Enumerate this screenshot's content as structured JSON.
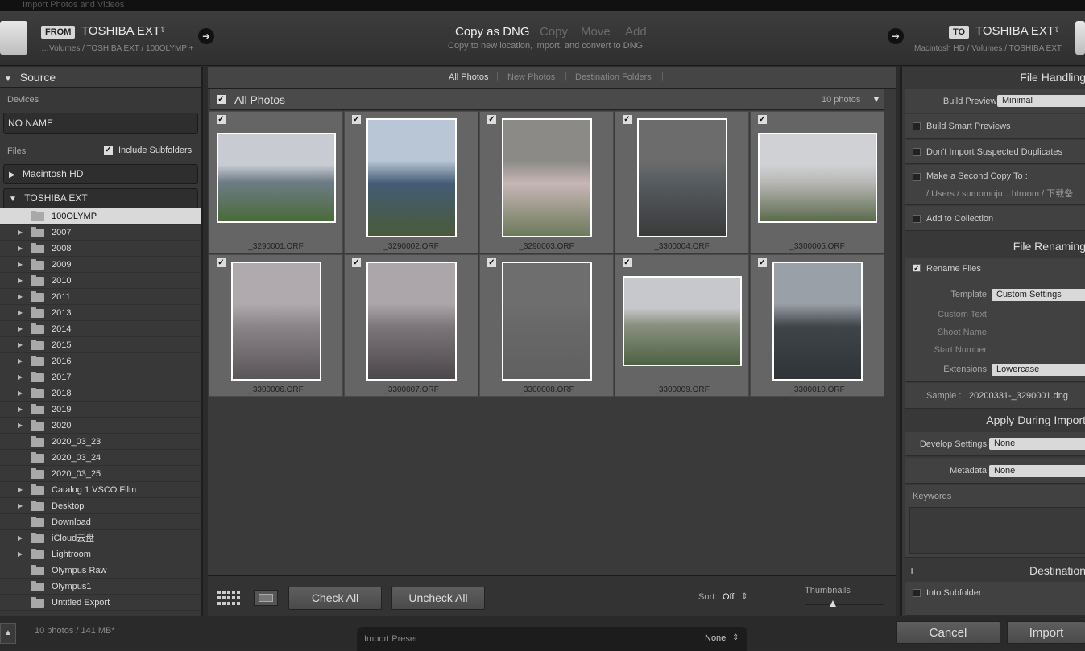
{
  "titlebar": "Import Photos and Videos",
  "from": {
    "tag": "FROM",
    "drive": "TOSHIBA EXT",
    "path": "…Volumes / TOSHIBA EXT / 100OLYMP +"
  },
  "to": {
    "tag": "TO",
    "drive": "TOSHIBA EXT",
    "path": "Macintosh HD / Volumes / TOSHIBA EXT"
  },
  "modes": {
    "copy_dng": "Copy as DNG",
    "copy": "Copy",
    "move": "Move",
    "add": "Add",
    "subtitle": "Copy to new location, import, and convert to DNG"
  },
  "source": {
    "title": "Source",
    "devices_label": "Devices",
    "device": "NO NAME",
    "files_label": "Files",
    "include_subfolders": "Include Subfolders",
    "volume1": "Macintosh HD",
    "volume2": "TOSHIBA EXT",
    "folders": [
      {
        "name": "100OLYMP",
        "tri": ""
      },
      {
        "name": "2007",
        "tri": "▶"
      },
      {
        "name": "2008",
        "tri": "▶"
      },
      {
        "name": "2009",
        "tri": "▶"
      },
      {
        "name": "2010",
        "tri": "▶"
      },
      {
        "name": "2011",
        "tri": "▶"
      },
      {
        "name": "2013",
        "tri": "▶"
      },
      {
        "name": "2014",
        "tri": "▶"
      },
      {
        "name": "2015",
        "tri": "▶"
      },
      {
        "name": "2016",
        "tri": "▶"
      },
      {
        "name": "2017",
        "tri": "▶"
      },
      {
        "name": "2018",
        "tri": "▶"
      },
      {
        "name": "2019",
        "tri": "▶"
      },
      {
        "name": "2020",
        "tri": "▶"
      },
      {
        "name": "2020_03_23",
        "tri": ""
      },
      {
        "name": "2020_03_24",
        "tri": ""
      },
      {
        "name": "2020_03_25",
        "tri": ""
      },
      {
        "name": "Catalog 1 VSCO Film",
        "tri": "▶"
      },
      {
        "name": "Desktop",
        "tri": "▶"
      },
      {
        "name": "Download",
        "tri": ""
      },
      {
        "name": "iCloud云盘",
        "tri": "▶"
      },
      {
        "name": "Lightroom",
        "tri": "▶"
      },
      {
        "name": "Olympus Raw",
        "tri": ""
      },
      {
        "name": "Olympus1",
        "tri": ""
      },
      {
        "name": "Untitled Export",
        "tri": ""
      }
    ]
  },
  "center": {
    "tabs": [
      "All Photos",
      "New Photos",
      "Destination Folders"
    ],
    "grid_title": "All Photos",
    "count": "10 photos",
    "photos": [
      {
        "name": "_3290001.ORF",
        "orient": "land",
        "colors": [
          "#c8ccd2",
          "#6e7c86",
          "#4a6a3a"
        ]
      },
      {
        "name": "_3290002.ORF",
        "orient": "port",
        "colors": [
          "#b8c6d6",
          "#445c74",
          "#4a5a3a"
        ]
      },
      {
        "name": "_3290003.ORF",
        "orient": "port",
        "colors": [
          "#8b8a86",
          "#c7b6b6",
          "#6d7a5a"
        ]
      },
      {
        "name": "_3300004.ORF",
        "orient": "port",
        "colors": [
          "#6c6c6c",
          "#555b60",
          "#3a3a3a"
        ]
      },
      {
        "name": "_3300005.ORF",
        "orient": "land",
        "colors": [
          "#cfd1d4",
          "#b8b8b6",
          "#5c6a4c"
        ]
      },
      {
        "name": "_3300006.ORF",
        "orient": "port",
        "colors": [
          "#b0aaae",
          "#8a8488",
          "#5a5558"
        ]
      },
      {
        "name": "_3300007.ORF",
        "orient": "port",
        "colors": [
          "#aca6aa",
          "#7c767a",
          "#4c474a"
        ]
      },
      {
        "name": "_3300008.ORF",
        "orient": "port",
        "colors": [
          "#6e6e6e",
          "#686868",
          "#606060"
        ]
      },
      {
        "name": "_3300009.ORF",
        "orient": "land",
        "colors": [
          "#c6c8cc",
          "#8a9080",
          "#4e6244"
        ]
      },
      {
        "name": "_3300010.ORF",
        "orient": "port",
        "colors": [
          "#9aa0a8",
          "#3e4448",
          "#2e3438"
        ]
      }
    ],
    "check_all": "Check All",
    "uncheck_all": "Uncheck All",
    "sort_label": "Sort:",
    "sort_value": "Off",
    "thumbnails_label": "Thumbnails"
  },
  "right": {
    "file_handling": "File Handling",
    "build_previews_label": "Build Previews",
    "build_previews_value": "Minimal",
    "smart_previews": "Build Smart Previews",
    "no_duplicates": "Don't Import Suspected Duplicates",
    "second_copy": "Make a Second Copy To :",
    "second_copy_path": "/ Users / sumomoju…htroom / 下载备",
    "add_collection": "Add to Collection",
    "file_renaming": "File Renaming",
    "rename_files": "Rename Files",
    "template_label": "Template",
    "template_value": "Custom Settings",
    "custom_text": "Custom Text",
    "shoot_name": "Shoot Name",
    "start_number": "Start Number",
    "extensions_label": "Extensions",
    "extensions_value": "Lowercase",
    "sample_label": "Sample :",
    "sample_value": "20200331-_3290001.dng",
    "apply_during_import": "Apply During Import",
    "develop_label": "Develop Settings",
    "develop_value": "None",
    "metadata_label": "Metadata",
    "metadata_value": "None",
    "keywords_label": "Keywords",
    "destination": "Destination",
    "into_subfolder": "Into Subfolder"
  },
  "footer": {
    "summary": "10 photos / 141 MB*",
    "preset_label": "Import Preset :",
    "preset_value": "None",
    "cancel": "Cancel",
    "import": "Import"
  }
}
